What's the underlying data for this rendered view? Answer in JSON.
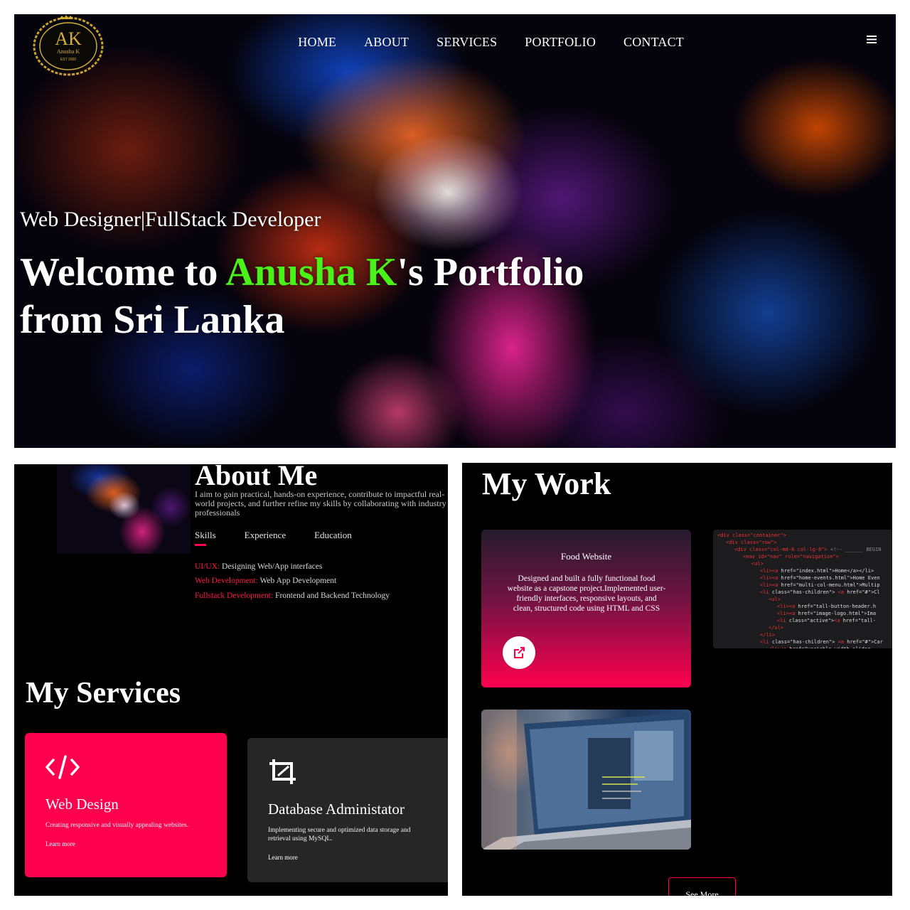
{
  "hero": {
    "logo": {
      "monogram": "AK",
      "name": "Anusha K",
      "est": "EST 2000"
    },
    "nav": [
      {
        "label": "HOME",
        "name": "nav-home"
      },
      {
        "label": "ABOUT",
        "name": "nav-about"
      },
      {
        "label": "SERVICES",
        "name": "nav-services"
      },
      {
        "label": "PORTFOLIO",
        "name": "nav-portfolio"
      },
      {
        "label": "CONTACT",
        "name": "nav-contact"
      }
    ],
    "menu_icon": "hamburger-menu-icon",
    "subtitle": "Web Designer|FullStack Developer",
    "title_prefix": "Welcome to ",
    "title_highlight": "Anusha K",
    "title_suffix": "'s Portfolio",
    "title_line2": "from Sri Lanka",
    "highlight_color": "#49f218"
  },
  "about": {
    "title": "About Me",
    "text": "I aim to gain practical, hands-on experience, contribute to impactful real-world projects, and further refine my skills by collaborating with industry professionals",
    "tabs": [
      "Skills",
      "Experience",
      "Education"
    ],
    "skills": [
      {
        "key": "UI/UX:",
        "value": " Designing Web/App interfaces"
      },
      {
        "key": "Web Development:",
        "value": " Web App Development"
      },
      {
        "key": "Fullstack Development:",
        "value": " Frontend and Backend Technology"
      }
    ]
  },
  "services": {
    "title": "My Services",
    "items": [
      {
        "icon": "code-icon",
        "title": "Web Design",
        "desc": "Creating responsive and visually appealing websites.",
        "link": "Learn more"
      },
      {
        "icon": "crop-icon",
        "title": "Database Administator",
        "desc": "Implementing secure and optimized data storage and retrieval using MySQL.",
        "link": "Learn more"
      }
    ]
  },
  "work": {
    "title": "My Work",
    "card1": {
      "title": "Food Website",
      "desc": "Designed and built a fully functional food website as a capstone project.Implemented user-friendly interfaces, responsive layouts, and clean, structured code using HTML and CSS",
      "icon": "external-link-icon"
    },
    "see_more": "See More"
  },
  "colors": {
    "accent": "#ff004f",
    "background": "#000000",
    "card_dark": "#262626"
  }
}
